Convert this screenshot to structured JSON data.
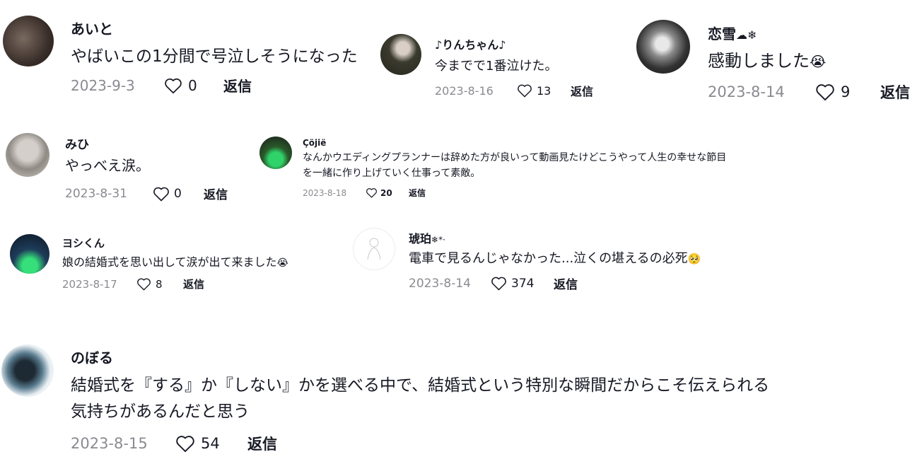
{
  "comments": [
    {
      "name": "あいと",
      "text": "やばいこの1分間で号泣しそうになった",
      "date": "2023-9-3",
      "likes": "0",
      "reply": "返信"
    },
    {
      "name": "♪りんちゃん♪",
      "text": "今までで1番泣けた。",
      "date": "2023-8-16",
      "likes": "13",
      "reply": "返信"
    },
    {
      "name": "恋雪",
      "name_suffix": "☁❄",
      "text": "感動しました",
      "text_suffix": "😭",
      "date": "2023-8-14",
      "likes": "9",
      "reply": "返信"
    },
    {
      "name": "みひ",
      "text": "やっべえ涙。",
      "date": "2023-8-31",
      "likes": "0",
      "reply": "返信"
    },
    {
      "name": "Çöjië",
      "text_line1": "なんかウエディングプランナーは辞めた方が良いって動画見たけどこうやって人生の幸せな節目",
      "text_line2": "を一緒に作り上げていく仕事って素敵。",
      "date": "2023-8-18",
      "likes": "20",
      "reply": "返信"
    },
    {
      "name": "ヨシくん",
      "text": "娘の結婚式を思い出して涙が出て来ました",
      "text_suffix": "😭",
      "date": "2023-8-17",
      "likes": "8",
      "reply": "返信"
    },
    {
      "name": "琥珀",
      "name_suffix": "❄*·",
      "text": "電車で見るんじゃなかった...泣くの堪えるの必死",
      "text_suffix": "🥺",
      "date": "2023-8-14",
      "likes": "374",
      "reply": "返信"
    },
    {
      "name": "のぼる",
      "text_line1": "結婚式を『する』か『しない』かを選べる中で、結婚式という特別な瞬間だからこそ伝えられる",
      "text_line2": "気持ちがあるんだと思う",
      "date": "2023-8-15",
      "likes": "54",
      "reply": "返信"
    }
  ],
  "icons": {
    "like": "heart-outline-icon"
  },
  "colors": {
    "text": "#161823",
    "meta": "#8a8b91",
    "background": "#ffffff"
  }
}
